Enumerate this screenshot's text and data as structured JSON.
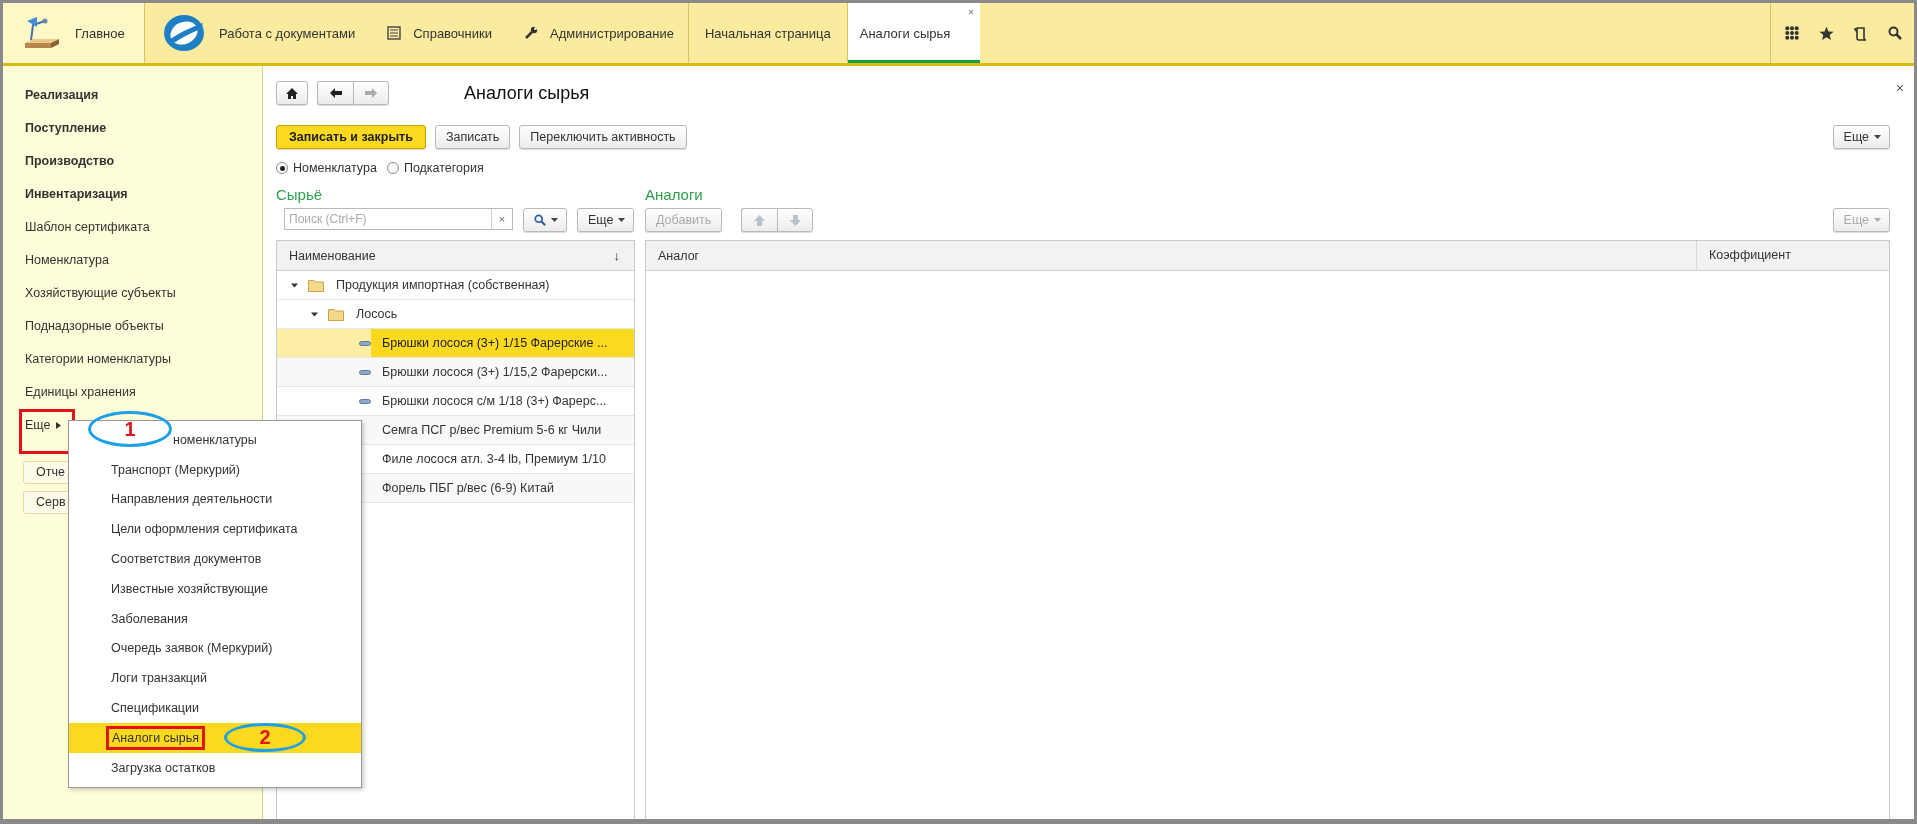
{
  "top_bar": {
    "sections": [
      {
        "kind": "home",
        "label": "Главное"
      },
      {
        "kind": "docs",
        "label": "Работа с документами"
      },
      {
        "kind": "refs",
        "label": "Справочники"
      },
      {
        "kind": "admin",
        "label": "Администрирование"
      }
    ],
    "tabs": [
      {
        "label": "Начальная страница",
        "selected": false
      },
      {
        "label": "Аналоги сырья",
        "selected": true,
        "close": "×"
      }
    ]
  },
  "sidebar": {
    "items": [
      {
        "label": "Реализация",
        "kind": "section"
      },
      {
        "label": "Поступление",
        "kind": "section"
      },
      {
        "label": "Производство",
        "kind": "section"
      },
      {
        "label": "Инвентаризация",
        "kind": "section"
      },
      {
        "label": "Шаблон сертификата",
        "kind": "link"
      },
      {
        "label": "Номенклатура",
        "kind": "link"
      },
      {
        "label": "Хозяйствующие субъекты",
        "kind": "link"
      },
      {
        "label": "Поднадзорные объекты",
        "kind": "link"
      },
      {
        "label": "Категории номенклатуры",
        "kind": "link"
      },
      {
        "label": "Единицы хранения",
        "kind": "link"
      },
      {
        "label": "Еще",
        "kind": "more",
        "callout": "1"
      }
    ],
    "buttons": [
      "Отче",
      "Серв"
    ]
  },
  "form": {
    "title": "Аналоги сырья",
    "close": "×",
    "commands": [
      {
        "label": "Записать и закрыть",
        "kind": "primary"
      },
      {
        "label": "Записать",
        "kind": "normal"
      },
      {
        "label": "Переключить активность",
        "kind": "normal"
      }
    ],
    "more": "Еще",
    "radios": [
      {
        "label": "Номенклатура",
        "selected": true
      },
      {
        "label": "Подкатегория",
        "selected": false
      }
    ],
    "raw": {
      "title": "Сырьё",
      "search_placeholder": "Поиск (Ctrl+F)",
      "clear": "×",
      "more": "Еще",
      "column": "Наименование",
      "sort_mark": "↓",
      "tree": [
        {
          "label": "Продукция импортная (собственная)",
          "kind": "folder",
          "expanded": true,
          "selected": false,
          "children": [
            {
              "label": "Лосось",
              "kind": "folder",
              "expanded": true,
              "selected": false,
              "children": [
                {
                  "label": "Брюшки лосося (3+) 1/15 Фарерские ...",
                  "kind": "item",
                  "marker": true,
                  "selected": true
                },
                {
                  "label": "Брюшки лосося (3+) 1/15,2 Фарерски...",
                  "kind": "item",
                  "marker": true,
                  "selected": false
                },
                {
                  "label": "Брюшки лосося с/м 1/18 (3+) Фарерс...",
                  "kind": "item",
                  "marker": true,
                  "selected": false
                },
                {
                  "label": "Семга ПСГ р/вес Premium 5-6 кг Чили",
                  "kind": "item",
                  "marker": false,
                  "selected": false
                },
                {
                  "label": "Филе лосося атл. 3-4 lb, Премиум 1/10",
                  "kind": "item",
                  "marker": false,
                  "selected": false
                },
                {
                  "label": "Форель ПБГ р/вес (6-9) Китай",
                  "kind": "item",
                  "marker": false,
                  "selected": false
                }
              ]
            }
          ]
        }
      ]
    },
    "analogs": {
      "title": "Аналоги",
      "add": {
        "label": "Добавить",
        "disabled": true
      },
      "move_disabled": true,
      "more": {
        "label": "Еще",
        "disabled": true
      },
      "columns": [
        "Аналог",
        "Коэффициент"
      ]
    }
  },
  "menu": {
    "items": [
      {
        "label": "номенклатуры",
        "selected": false
      },
      {
        "label": "Транспорт (Меркурий)",
        "selected": false
      },
      {
        "label": "Направления деятельности",
        "selected": false
      },
      {
        "label": "Цели оформления сертификата",
        "selected": false
      },
      {
        "label": "Соответствия документов",
        "selected": false
      },
      {
        "label": "Известные хозяйствующие",
        "selected": false
      },
      {
        "label": "Заболевания",
        "selected": false
      },
      {
        "label": "Очередь заявок (Меркурий)",
        "selected": false
      },
      {
        "label": "Логи транзакций",
        "selected": false
      },
      {
        "label": "Спецификации",
        "selected": false
      },
      {
        "label": "Аналоги сырья",
        "selected": true,
        "callout": "2"
      },
      {
        "label": "Загрузка остатков",
        "selected": false
      }
    ]
  }
}
